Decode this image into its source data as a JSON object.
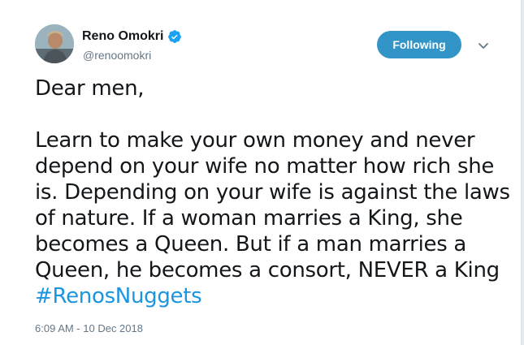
{
  "author": {
    "display_name": "Reno Omokri",
    "handle": "@renoomokri",
    "verified": true
  },
  "follow_button": {
    "label": "Following",
    "color": "#3394c7"
  },
  "tweet": {
    "greeting": "Dear men,",
    "lines": [
      "Learn to make your own money and never",
      "depend on your wife no matter how rich she",
      "is. Depending on your wife is against the laws",
      "of nature. If a woman marries a King, she",
      "becomes a Queen. But if a man marries a",
      "Queen, he becomes a consort, NEVER a King"
    ],
    "hashtag": "#RenosNuggets"
  },
  "timestamp": "6:09 AM - 10 Dec 2018",
  "icons": {
    "verified": "verified-badge-icon",
    "caret": "chevron-down-icon"
  },
  "colors": {
    "link": "#1b95e0",
    "verified": "#1da1f2",
    "secondary_text": "#657786"
  }
}
